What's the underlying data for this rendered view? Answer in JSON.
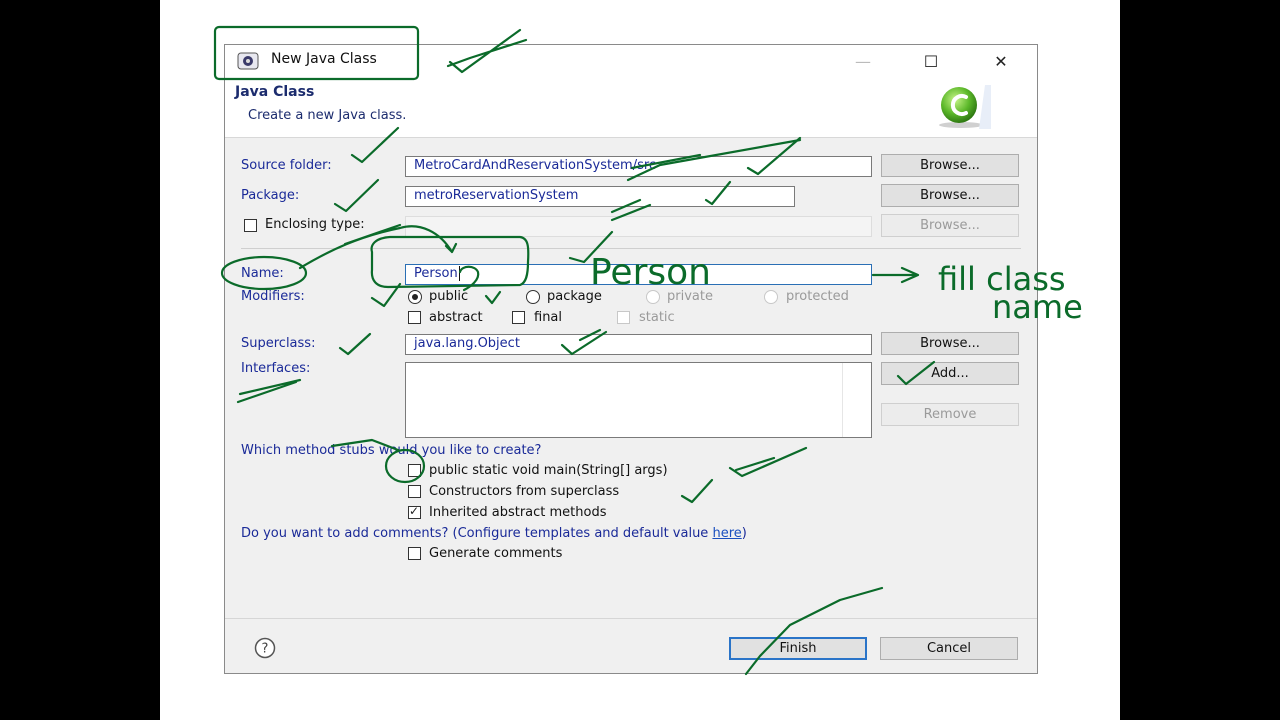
{
  "window": {
    "title": "New Java Class",
    "controls": {
      "minimize": "—",
      "maximize": "☐",
      "close": "✕"
    }
  },
  "header": {
    "title": "Java Class",
    "subtitle": "Create a new Java class."
  },
  "form": {
    "source_folder": {
      "label": "Source folder:",
      "value": "MetroCardAndReservationSystem/src",
      "button": "Browse..."
    },
    "package": {
      "label": "Package:",
      "value": "metroReservationSystem",
      "button": "Browse..."
    },
    "enclosing_type": {
      "label": "Enclosing type:",
      "checked": false,
      "value": "",
      "button": "Browse..."
    },
    "name": {
      "label": "Name:",
      "value": "Person"
    },
    "modifiers": {
      "label": "Modifiers:",
      "access": [
        "public",
        "package",
        "private",
        "protected"
      ],
      "selected_access": "public",
      "abstract": "abstract",
      "final": "final",
      "static": "static"
    },
    "superclass": {
      "label": "Superclass:",
      "value": "java.lang.Object",
      "button": "Browse..."
    },
    "interfaces": {
      "label": "Interfaces:",
      "add_button": "Add...",
      "remove_button": "Remove"
    },
    "method_stubs": {
      "question": "Which method stubs would you like to create?",
      "options": [
        {
          "label": "public static void main(String[] args)",
          "checked": false
        },
        {
          "label": "Constructors from superclass",
          "checked": false
        },
        {
          "label": "Inherited abstract methods",
          "checked": true
        }
      ]
    },
    "comments": {
      "question_prefix": "Do you want to add comments? (Configure templates and default value ",
      "link": "here",
      "question_suffix": ")",
      "generate_label": "Generate comments",
      "checked": false
    }
  },
  "footer": {
    "help": "?",
    "finish": "Finish",
    "cancel": "Cancel"
  },
  "annotations": {
    "handwritten_person": "Person",
    "note_line1": "fill class",
    "note_line2": "name",
    "ink_color": "#0b6b2a"
  }
}
